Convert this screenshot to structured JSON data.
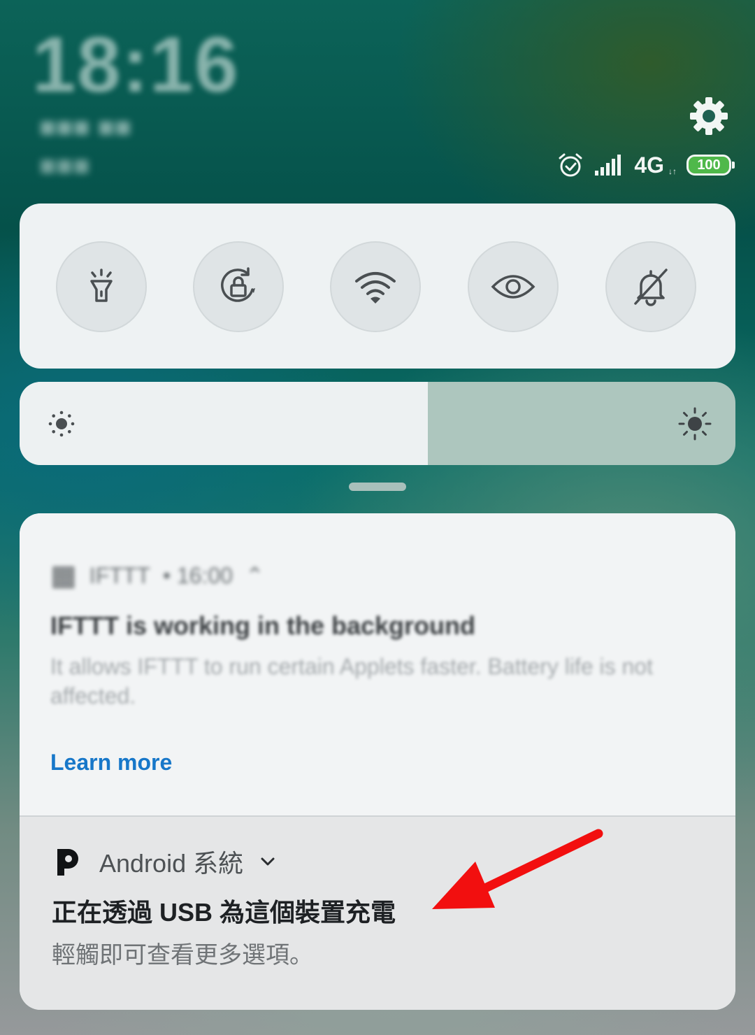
{
  "header": {
    "time": "18:16",
    "date": "■■■ ■■",
    "day": "■■■",
    "network_type": "4G",
    "network_arrows": "↓↑",
    "battery_level": "100"
  },
  "quick_settings": {
    "tiles": [
      {
        "name": "flashlight",
        "icon": "flashlight-icon"
      },
      {
        "name": "rotation-lock",
        "icon": "rotation-lock-icon"
      },
      {
        "name": "wifi",
        "icon": "wifi-icon"
      },
      {
        "name": "reading-mode",
        "icon": "eye-icon"
      },
      {
        "name": "silent",
        "icon": "bell-off-icon"
      }
    ]
  },
  "brightness": {
    "level": 0.57
  },
  "notifications": {
    "ifttt": {
      "app_name": "IFTTT",
      "time_ago": "• 16:00",
      "title": "IFTTT is working in the background",
      "body": "It allows IFTTT to run certain Applets faster. Battery life is not affected.",
      "action_label": "Learn more"
    },
    "usb": {
      "app_name": "Android 系統",
      "title": "正在透過 USB 為這個裝置充電",
      "subtitle": "輕觸即可查看更多選項。"
    }
  },
  "colors": {
    "accent_link": "#1777c9",
    "battery_green": "#4fb84a",
    "annotation_arrow": "#f20f0f"
  }
}
